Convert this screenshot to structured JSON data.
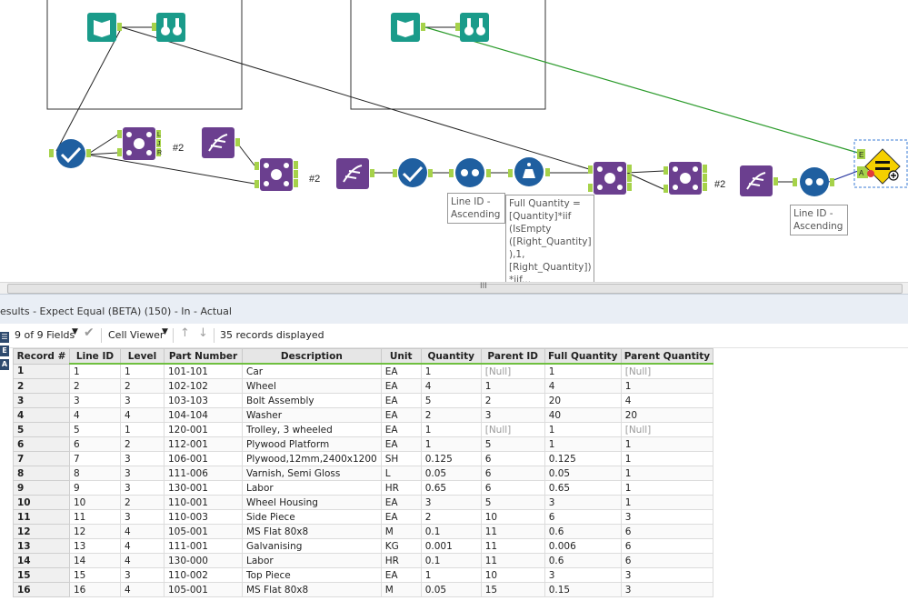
{
  "canvas": {
    "join_labels": [
      "L",
      "J",
      "R"
    ],
    "hash_labels": [
      "#2",
      "#2",
      "#2"
    ],
    "annotations": {
      "sort1": [
        "Line ID -",
        "Ascending"
      ],
      "formula": [
        "Full Quantity =",
        "[Quantity]*iif",
        "(IsEmpty",
        "([Right_Quantity]",
        "),1,",
        "[Right_Quantity])",
        "*iif..."
      ],
      "sort2": [
        "Line ID -",
        "Ascending"
      ]
    },
    "expect_anchors": {
      "e": "E",
      "a": "A"
    }
  },
  "scroll": {
    "grip": "III"
  },
  "results": {
    "title": "esults - Expect Equal (BETA) (150) - In - Actual"
  },
  "toolbar": {
    "fields": "9 of 9 Fields",
    "viewer": "Cell Viewer",
    "records": "35 records displayed"
  },
  "side_icons": [
    "☰",
    "E",
    "A"
  ],
  "table": {
    "columns": [
      "Record #",
      "Line ID",
      "Level",
      "Part Number",
      "Description",
      "Unit",
      "Quantity",
      "Parent ID",
      "Full Quantity",
      "Parent Quantity"
    ],
    "rows": [
      [
        "1",
        "1",
        "1",
        "101-101",
        "Car",
        "EA",
        "1",
        "[Null]",
        "1",
        "[Null]"
      ],
      [
        "2",
        "2",
        "2",
        "102-102",
        "Wheel",
        "EA",
        "4",
        "1",
        "4",
        "1"
      ],
      [
        "3",
        "3",
        "3",
        "103-103",
        "Bolt Assembly",
        "EA",
        "5",
        "2",
        "20",
        "4"
      ],
      [
        "4",
        "4",
        "4",
        "104-104",
        "Washer",
        "EA",
        "2",
        "3",
        "40",
        "20"
      ],
      [
        "5",
        "5",
        "1",
        "120-001",
        "Trolley, 3 wheeled",
        "EA",
        "1",
        "[Null]",
        "1",
        "[Null]"
      ],
      [
        "6",
        "6",
        "2",
        "112-001",
        "Plywood Platform",
        "EA",
        "1",
        "5",
        "1",
        "1"
      ],
      [
        "7",
        "7",
        "3",
        "106-001",
        "Plywood,12mm,2400x1200",
        "SH",
        "0.125",
        "6",
        "0.125",
        "1"
      ],
      [
        "8",
        "8",
        "3",
        "111-006",
        "Varnish, Semi Gloss",
        "L",
        "0.05",
        "6",
        "0.05",
        "1"
      ],
      [
        "9",
        "9",
        "3",
        "130-001",
        "Labor",
        "HR",
        "0.65",
        "6",
        "0.65",
        "1"
      ],
      [
        "10",
        "10",
        "2",
        "110-001",
        "Wheel Housing",
        "EA",
        "3",
        "5",
        "3",
        "1"
      ],
      [
        "11",
        "11",
        "3",
        "110-003",
        "Side Piece",
        "EA",
        "2",
        "10",
        "6",
        "3"
      ],
      [
        "12",
        "12",
        "4",
        "105-001",
        "MS Flat 80x8",
        "M",
        "0.1",
        "11",
        "0.6",
        "6"
      ],
      [
        "13",
        "13",
        "4",
        "111-001",
        "Galvanising",
        "KG",
        "0.001",
        "11",
        "0.006",
        "6"
      ],
      [
        "14",
        "14",
        "4",
        "130-000",
        "Labor",
        "HR",
        "0.1",
        "11",
        "0.6",
        "6"
      ],
      [
        "15",
        "15",
        "3",
        "110-002",
        "Top Piece",
        "EA",
        "1",
        "10",
        "3",
        "3"
      ],
      [
        "16",
        "16",
        "4",
        "105-001",
        "MS Flat 80x8",
        "M",
        "0.05",
        "15",
        "0.15",
        "3"
      ]
    ]
  },
  "colors": {
    "input_tool": "#1a9b8a",
    "join_tool": "#6b3f8f",
    "blue_tool": "#1f5fa0",
    "connector": "#222222",
    "green_link": "#2a9a2a",
    "anchor": "#a6d24a",
    "header_accent": "#6fbf3f"
  }
}
